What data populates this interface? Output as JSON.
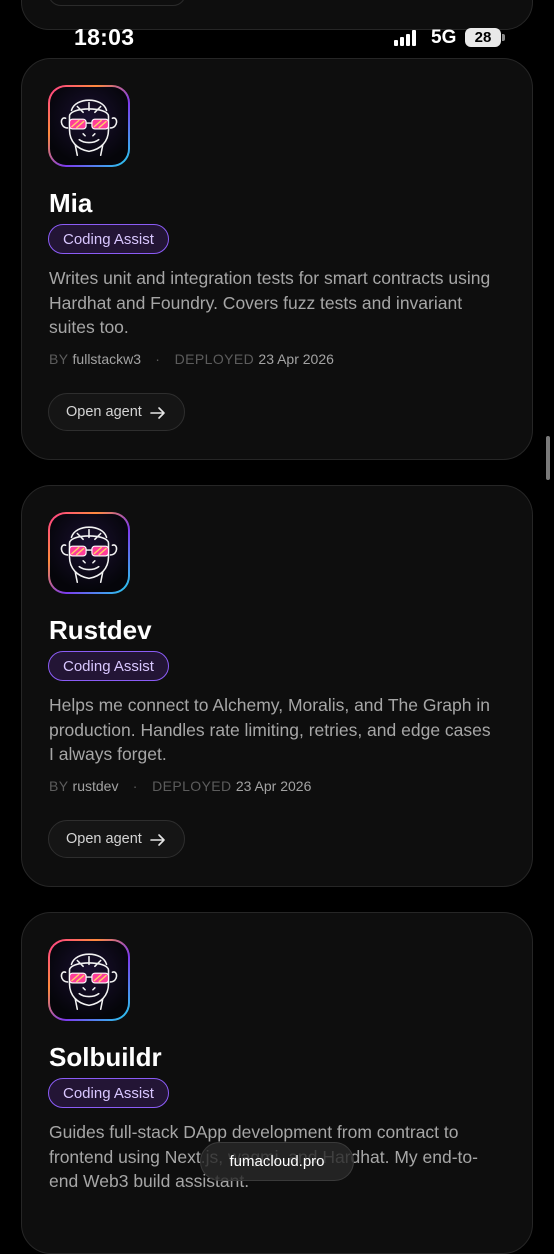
{
  "status_bar": {
    "time": "18:03",
    "network": "5G",
    "battery": "28"
  },
  "agents": [
    {
      "name": "Mia",
      "tag": "Coding Assist",
      "description": "Writes unit and integration tests for smart contracts using Hardhat and Foundry. Covers fuzz tests and invariant suites too.",
      "by_label": "BY",
      "author": "fullstackw3",
      "deployed_label": "DEPLOYED",
      "deployed_date": "23 Apr 2026",
      "button_label": "Open agent",
      "icon": "ape-sunglasses-logo"
    },
    {
      "name": "Rustdev",
      "tag": "Coding Assist",
      "description": "Helps me connect to Alchemy, Moralis, and The Graph in production. Handles rate limiting, retries, and edge cases I always forget.",
      "by_label": "BY",
      "author": "rustdev",
      "deployed_label": "DEPLOYED",
      "deployed_date": "23 Apr 2026",
      "button_label": "Open agent",
      "icon": "ape-sunglasses-logo"
    },
    {
      "name": "Solbuildr",
      "tag": "Coding Assist",
      "description": "Guides full-stack DApp development from contract to frontend using Next.js, wagmi, and Hardhat. My end-to-end Web3 build assistant.",
      "icon": "ape-sunglasses-logo"
    }
  ],
  "browser": {
    "url": "fumacloud.pro"
  }
}
